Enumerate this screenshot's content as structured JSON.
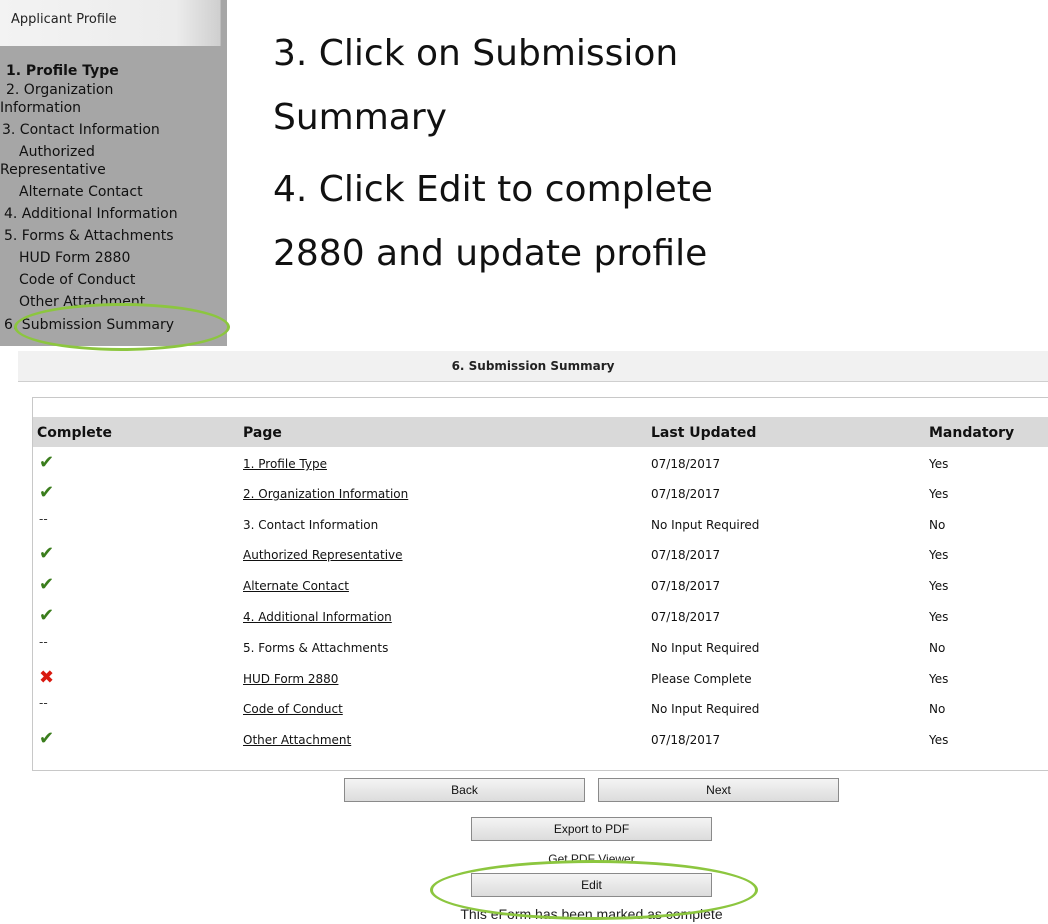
{
  "nav": {
    "header": "Applicant Profile",
    "items": [
      {
        "label": "1. Profile Type"
      },
      {
        "label": "2. Organization"
      },
      {
        "label": "Information"
      },
      {
        "label": "3. Contact Information"
      },
      {
        "label": "Authorized"
      },
      {
        "label": "Representative"
      },
      {
        "label": "Alternate Contact"
      },
      {
        "label": "4. Additional Information"
      },
      {
        "label": "5. Forms & Attachments"
      },
      {
        "label": "HUD Form 2880"
      },
      {
        "label": "Code of Conduct"
      },
      {
        "label": "Other Attachment"
      },
      {
        "label": "6. Submission Summary"
      }
    ]
  },
  "instructions": {
    "step3_line1": "3. Click on Submission",
    "step3_line2": "Summary",
    "step4_line1": "4. Click Edit to complete",
    "step4_line2": "2880 and update profile"
  },
  "summary": {
    "title": "6. Submission Summary",
    "columns": [
      "Complete",
      "Page",
      "Last Updated",
      "Mandatory"
    ],
    "rows": [
      {
        "status": "✔",
        "page": "1. Profile Type",
        "updated": "07/18/2017",
        "mandatory": "Yes"
      },
      {
        "status": "✔",
        "page": "2. Organization Information",
        "updated": "07/18/2017",
        "mandatory": "Yes"
      },
      {
        "status": "--",
        "page": "3. Contact Information",
        "updated": "No Input Required",
        "mandatory": "No"
      },
      {
        "status": "✔",
        "page": "Authorized Representative",
        "updated": "07/18/2017",
        "mandatory": "Yes"
      },
      {
        "status": "✔",
        "page": "Alternate Contact",
        "updated": "07/18/2017",
        "mandatory": "Yes"
      },
      {
        "status": "✔",
        "page": "4. Additional Information",
        "updated": "07/18/2017",
        "mandatory": "Yes"
      },
      {
        "status": "--",
        "page": "5. Forms & Attachments",
        "updated": "No Input Required",
        "mandatory": "No"
      },
      {
        "status": "✖",
        "page": "HUD Form 2880",
        "updated": "Please Complete",
        "mandatory": "Yes"
      },
      {
        "status": "--",
        "page": "Code of Conduct",
        "updated": "No Input Required",
        "mandatory": "No"
      },
      {
        "status": "✔",
        "page": "Other Attachment",
        "updated": "07/18/2017",
        "mandatory": "Yes"
      }
    ]
  },
  "buttons": {
    "back": "Back",
    "next": "Next",
    "export": "Export to PDF",
    "pdf_viewer": "Get PDF Viewer",
    "edit": "Edit"
  },
  "footer_note": "This eForm has been marked as complete",
  "colors": {
    "highlight": "#8cc63f",
    "check": "#3a7d1c",
    "cross": "#d9190f"
  }
}
